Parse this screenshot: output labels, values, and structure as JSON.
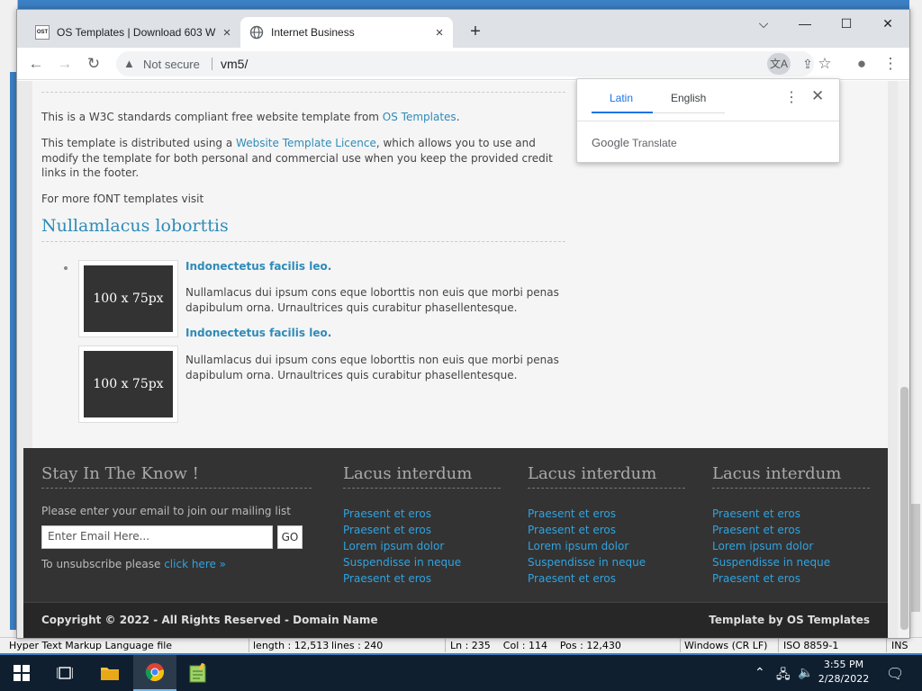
{
  "background_app": {
    "status": {
      "filetype": "Hyper Text Markup Language file",
      "length": "length : 12,513",
      "lines": "lines : 240",
      "position": "Ln : 235    Col : 114    Pos : 12,430",
      "eol": "Windows (CR LF)",
      "encoding": "ISO 8859-1",
      "mode": "INS"
    }
  },
  "browser": {
    "tabs": [
      {
        "title": "OS Templates | Download 603 W",
        "favicon": "ost-favicon",
        "active": false
      },
      {
        "title": "Internet Business",
        "favicon": "globe-icon",
        "active": true
      }
    ],
    "close_glyph": "×",
    "new_tab_glyph": "+",
    "window_controls": {
      "dropdown": "⌵",
      "minimize": "—",
      "maximize": "☐",
      "close": "✕"
    },
    "toolbar": {
      "back": "←",
      "forward": "→",
      "reload": "↻",
      "security_label": "Not secure",
      "url": "vm5/",
      "translate_icon": "文A",
      "share_icon": "⇪",
      "star_icon": "☆",
      "profile_icon": "●",
      "menu_icon": "⋮"
    }
  },
  "translate_popup": {
    "tabs": [
      "Latin",
      "English"
    ],
    "active_tab": "Latin",
    "brand": "Google",
    "product": "Translate",
    "menu_glyph": "⋮",
    "close_glyph": "✕"
  },
  "page": {
    "intro": {
      "line1_prefix": "This is a W3C standards compliant free website template from ",
      "line1_link": "OS Templates",
      "line1_suffix": ".",
      "line2_prefix": "This template is distributed using a ",
      "line2_link": "Website Template Licence",
      "line2_suffix": ", which allows you to use and modify the template for both personal and commercial use when you keep the provided credit links in the footer.",
      "line3": "For more fONT templates visit"
    },
    "section_heading": "Nullamlacus loborttis",
    "items": [
      {
        "image_label": "100 x 75px",
        "title": "Indonectetus facilis leo.",
        "text": "Nullamlacus dui ipsum cons eque loborttis non euis que morbi penas dapibulum orna. Urnaultrices quis curabitur phasellentesque."
      },
      {
        "image_label": "100 x 75px",
        "title": "Indonectetus facilis leo.",
        "text": "Nullamlacus dui ipsum cons eque loborttis non euis que morbi penas dapibulum orna. Urnaultrices quis curabitur phasellentesque."
      }
    ],
    "footer": {
      "newsletter": {
        "heading": "Stay In The Know !",
        "prompt": "Please enter your email to join our mailing list",
        "placeholder": "Enter Email Here...",
        "button": "GO",
        "unsubscribe_prefix": "To unsubscribe please ",
        "unsubscribe_link": "click here »"
      },
      "columns": [
        {
          "heading": "Lacus interdum",
          "links": [
            "Praesent et eros",
            "Praesent et eros",
            "Lorem ipsum dolor",
            "Suspendisse in neque",
            "Praesent et eros"
          ]
        },
        {
          "heading": "Lacus interdum",
          "links": [
            "Praesent et eros",
            "Praesent et eros",
            "Lorem ipsum dolor",
            "Suspendisse in neque",
            "Praesent et eros"
          ]
        },
        {
          "heading": "Lacus interdum",
          "links": [
            "Praesent et eros",
            "Praesent et eros",
            "Lorem ipsum dolor",
            "Suspendisse in neque",
            "Praesent et eros"
          ]
        }
      ],
      "copyright": "Copyright © 2022 - All Rights Reserved - Domain Name",
      "credit": "Template by OS Templates"
    }
  },
  "taskbar": {
    "time": "3:55 PM",
    "date": "2/28/2022",
    "apps": [
      "start-icon",
      "task-view-icon",
      "file-explorer-icon",
      "chrome-icon",
      "notepad-plus-icon"
    ]
  },
  "colors": {
    "link": "#2e8bb8",
    "footer_bg": "#333333",
    "footer_link": "#2fa3e0",
    "accent": "#1a73e8"
  }
}
